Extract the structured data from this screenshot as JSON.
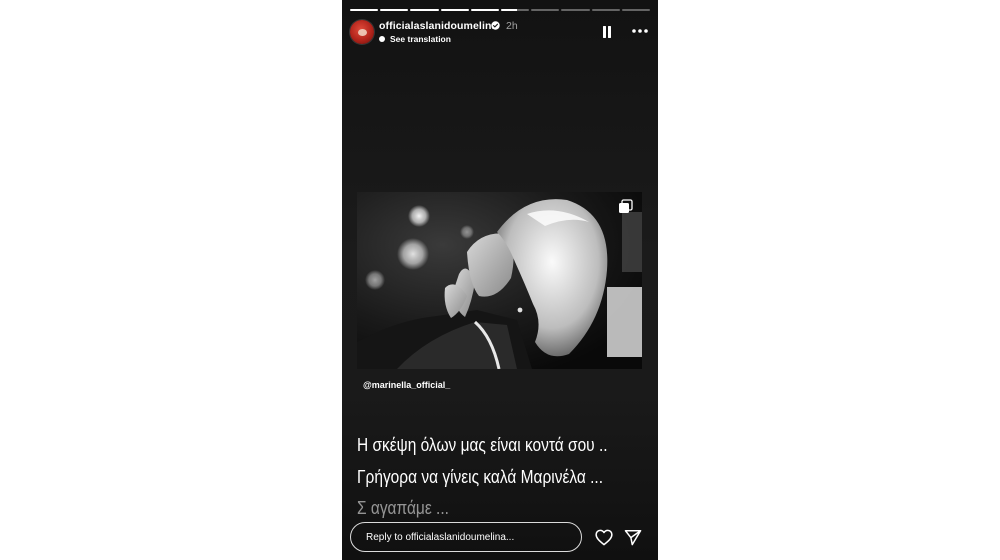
{
  "story": {
    "progress_segments": [
      1,
      1,
      1,
      1,
      1,
      0.55,
      0,
      0,
      0,
      0
    ],
    "header": {
      "username": "officialaslanidoumelina",
      "time": "2h",
      "translation_label": "See translation",
      "avatar_icon": "avatar-red",
      "verified_icon": "verified-badge-icon",
      "pause_icon": "pause-icon",
      "more_icon": "more-icon"
    },
    "media": {
      "multi_icon": "carousel-icon",
      "mention": "@marinella_official_"
    },
    "caption": {
      "line1": "Η σκέψη όλων μας είναι κοντά σου ..",
      "line2": "Γρήγορα να γίνεις καλά Μαρινέλα ...",
      "line3": "Σ αγαπάμε ..."
    },
    "footer": {
      "reply_placeholder": "Reply to officialaslanidoumelina...",
      "like_icon": "heart-icon",
      "share_icon": "send-icon"
    }
  }
}
